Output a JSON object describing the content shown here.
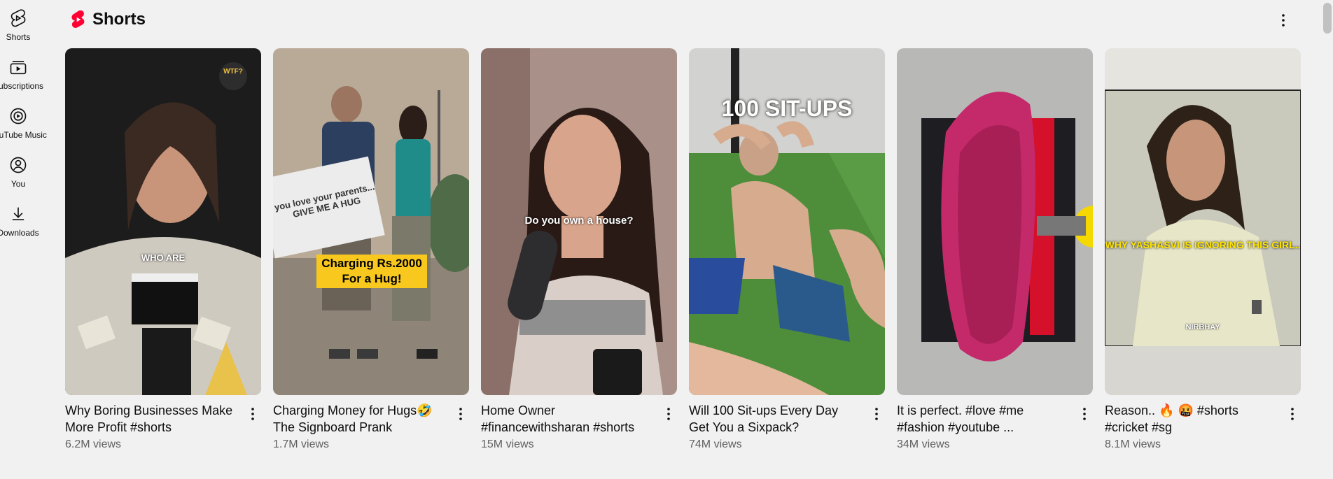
{
  "guide": {
    "items": [
      {
        "label": "Shorts",
        "icon": "shorts-icon"
      },
      {
        "label": "Subscriptions",
        "icon": "subscriptions-icon"
      },
      {
        "label": "YouTube Music",
        "icon": "youtube-music-icon"
      },
      {
        "label": "You",
        "icon": "you-icon"
      },
      {
        "label": "Downloads",
        "icon": "download-icon"
      }
    ]
  },
  "shelf": {
    "title": "Shorts",
    "accent": "#ff0033"
  },
  "cards": [
    {
      "title": "Why Boring Businesses Make More Profit #shorts",
      "views": "6.2M views",
      "overlay": "WHO ARE",
      "logo": "WTF?"
    },
    {
      "title": "Charging Money for Hugs🤣 The Signboard Prank",
      "views": "1.7M views",
      "overlay": "Charging Rs.2000 For a Hug!",
      "sign": "you love your parents... GIVE ME A HUG"
    },
    {
      "title": "Home Owner #financewithsharan #shorts",
      "views": "15M views",
      "overlay": "Do you own a house?"
    },
    {
      "title": "Will 100 Sit-ups Every Day Get You a Sixpack?",
      "views": "74M views",
      "overlay": "100 SIT-UPS"
    },
    {
      "title": "It is perfect. #love #me #fashion #youtube ...",
      "views": "34M views",
      "overlay": ""
    },
    {
      "title": "Reason.. 🔥 🤬 #shorts #cricket #sg",
      "views": "8.1M views",
      "overlay": "WHY YASHASVI IS IGNORING THIS GIRL..",
      "caption": "NIRBHAY"
    }
  ]
}
